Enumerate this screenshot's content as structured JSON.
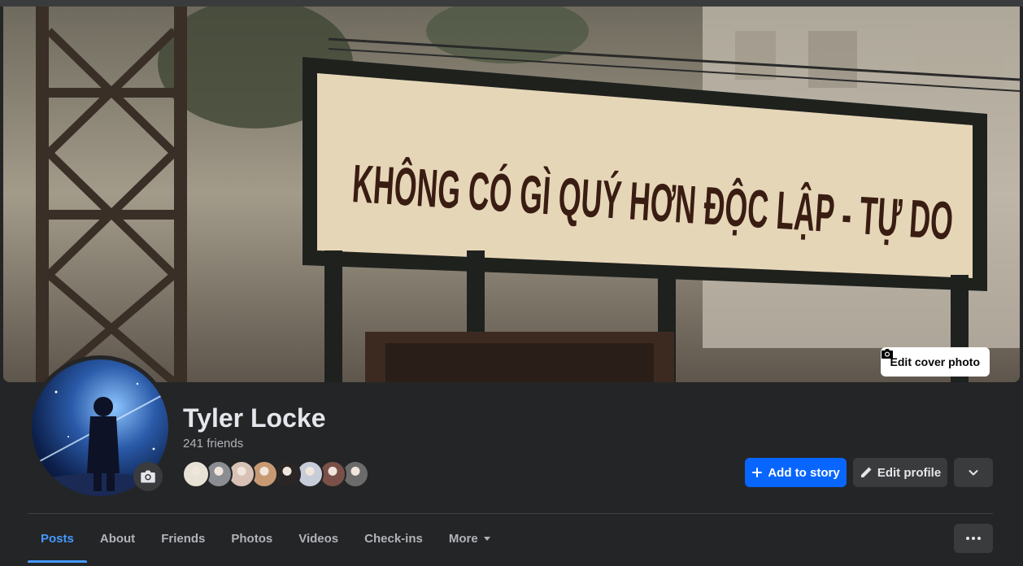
{
  "cover": {
    "sign_text": "KHÔNG CÓ GÌ QUÝ HƠN ĐỘC LẬP - TỰ DO",
    "edit_label": "Edit cover photo",
    "edit_icon": "camera-icon"
  },
  "profile": {
    "name": "Tyler Locke",
    "friends": "241 friends",
    "avatar_icon": "camera-icon",
    "friend_face_colors": [
      "#e8e2d6",
      "#8a8d91",
      "#d8c2b6",
      "#c79a74",
      "#2b2626",
      "#c6ccd8",
      "#7a5048",
      "#6b6b6b"
    ]
  },
  "actions": {
    "add_story": "Add to story",
    "add_story_icon": "plus-icon",
    "edit_profile": "Edit profile",
    "edit_profile_icon": "pencil-icon",
    "expand_icon": "chevron-down-icon",
    "more_icon": "ellipsis-icon"
  },
  "tabs": [
    {
      "label": "Posts",
      "active": true
    },
    {
      "label": "About"
    },
    {
      "label": "Friends"
    },
    {
      "label": "Photos"
    },
    {
      "label": "Videos"
    },
    {
      "label": "Check-ins"
    },
    {
      "label": "More",
      "icon": "caret-down-icon"
    }
  ],
  "colors": {
    "background": "#242526",
    "primary": "#0866ff",
    "active_tab": "#4599ff",
    "secondary_button": "#3a3b3c"
  }
}
